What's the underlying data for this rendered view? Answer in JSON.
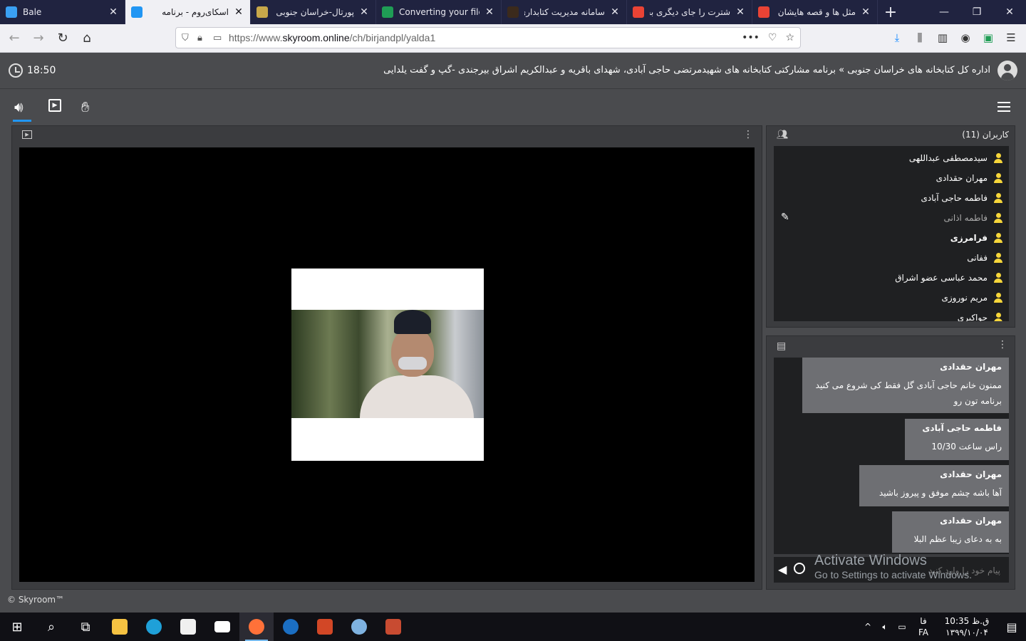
{
  "browser": {
    "tabs": [
      {
        "label": "Bale",
        "ltr": true,
        "color": "#3aa0f3",
        "active": false
      },
      {
        "label": "اسکای‌روم - برنامه",
        "ltr": false,
        "color": "#2196f3",
        "active": true
      },
      {
        "label": "پورتال-خراسان جنوبی",
        "ltr": false,
        "color": "#c8a84a",
        "active": false
      },
      {
        "label": "Converting your file",
        "ltr": true,
        "color": "#1f9d55",
        "active": false
      },
      {
        "label": "سامانه مدیریت کتابداری",
        "ltr": false,
        "color": "#3b2a1c",
        "active": false
      },
      {
        "label": "شترت را جای دیگری بخو",
        "ltr": false,
        "color": "#ea4335",
        "active": false
      },
      {
        "label": "مثل ها و قصه هایشان",
        "ltr": false,
        "color": "#ea4335",
        "active": false
      }
    ],
    "url_prefix": "https://www.",
    "url_domain": "skyroom.online",
    "url_path": "/ch/birjandpl/yalda1"
  },
  "app": {
    "time": "18:50",
    "room_title": "اداره کل کتابخانه های خراسان جنوبی » برنامه مشارکتی کتابخانه های شهیدمرتضی حاجی آبادی، شهدای باقریه و عبدالکریم اشراق بیرجندی -گپ و گفت یلدایی"
  },
  "users_panel": {
    "title": "کاربران (11)",
    "users": [
      {
        "name": "سیدمصطفی عبداللهی",
        "style": ""
      },
      {
        "name": "مهران حقدادی",
        "style": ""
      },
      {
        "name": "فاطمه حاجی آبادی",
        "style": ""
      },
      {
        "name": "فاطمه اذانی",
        "style": "muted"
      },
      {
        "name": "فرامرزی",
        "style": "bold"
      },
      {
        "name": "ففانی",
        "style": ""
      },
      {
        "name": "محمد عباسی عضو اشراق",
        "style": ""
      },
      {
        "name": "مریم نوروزی",
        "style": ""
      },
      {
        "name": "حواکبری",
        "style": ""
      }
    ]
  },
  "chat": {
    "messages": [
      {
        "sender": "مهران حقدادی",
        "lines": [
          "ممنون خانم حاجی آبادی گل فقط کی شروع می کنید",
          "برنامه تون رو"
        ]
      },
      {
        "sender": "فاطمه حاجی آبادی",
        "lines": [
          "راس ساعت 10/30"
        ]
      },
      {
        "sender": "مهران حقدادی",
        "lines": [
          "آها باشه چشم موفق و پیروز باشید"
        ]
      },
      {
        "sender": "مهران حقدادی",
        "lines": [
          "به به دعای زیبا عظم البلا"
        ]
      }
    ],
    "placeholder": "پیام خود را وارد کنید"
  },
  "watermark": {
    "line1": "Activate Windows",
    "line2": "Go to Settings to activate Windows."
  },
  "footer": "© Skyroom™",
  "taskbar": {
    "lang_top": "فا",
    "lang_bottom": "FA",
    "time": "ق.ظ 10:35",
    "date": "۱۳۹۹/۱۰/۰۴"
  }
}
